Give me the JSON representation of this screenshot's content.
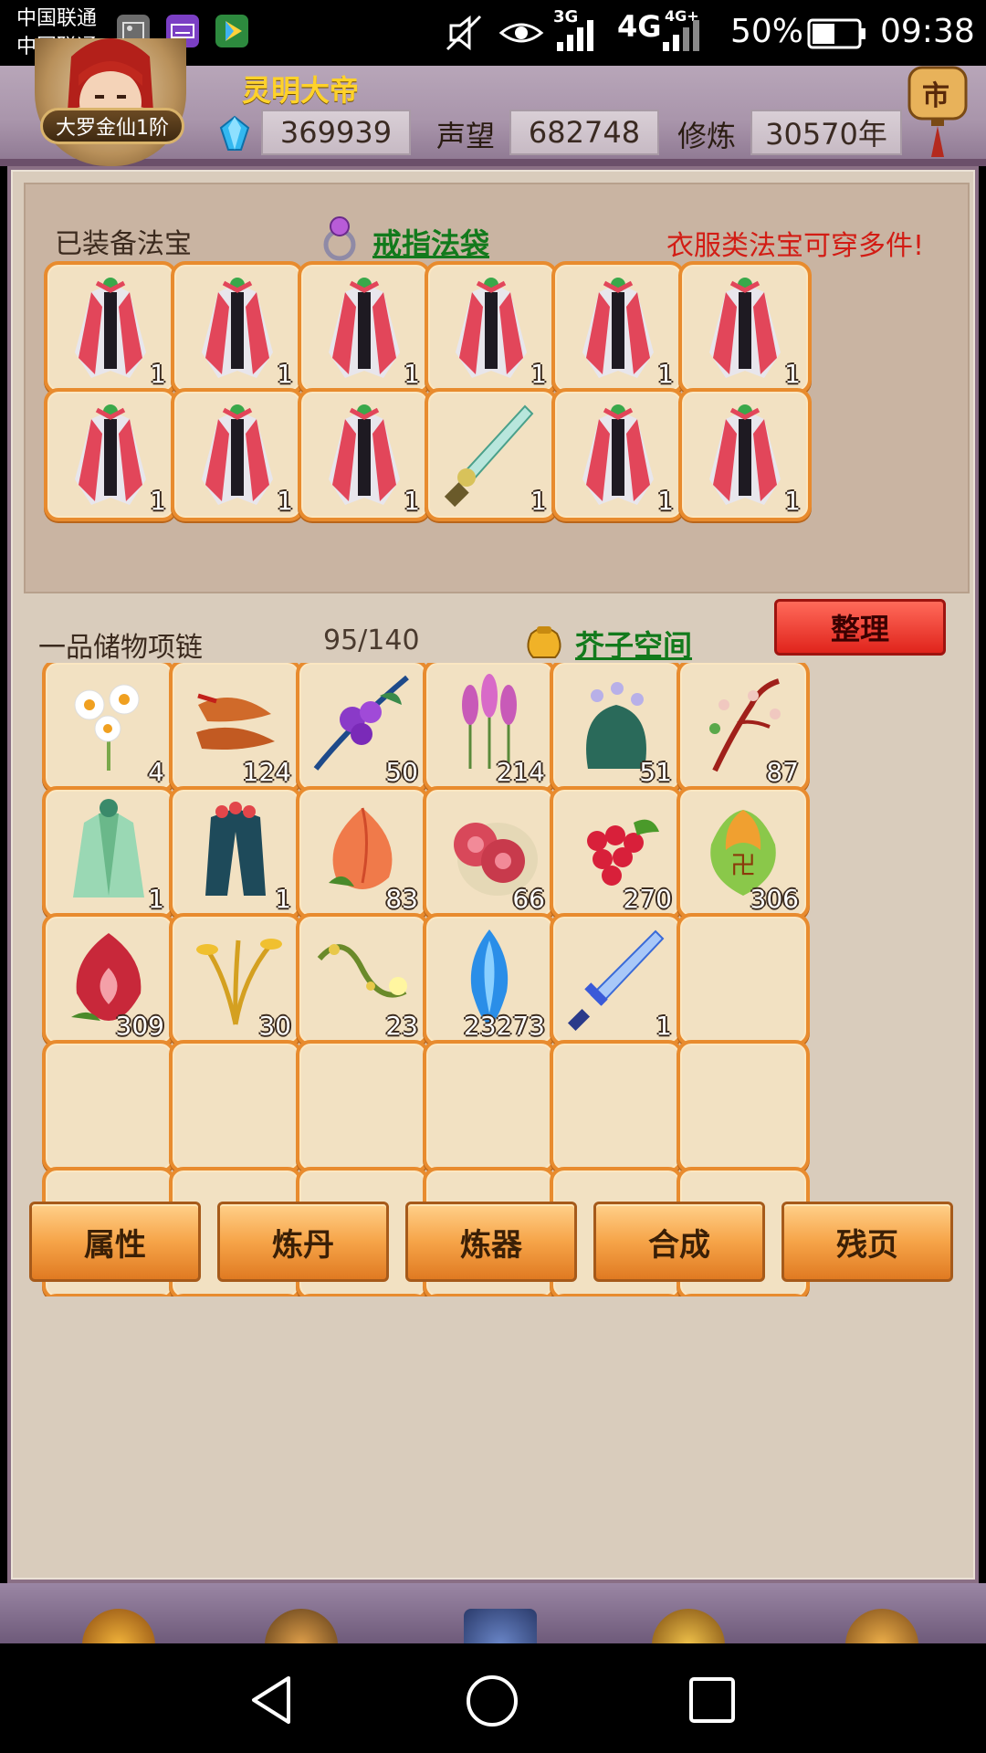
{
  "statusbar": {
    "carrier1": "中国联通",
    "carrier2": "中国联通",
    "net_3g": "3G",
    "net_4g": "4G",
    "net_4g_plus": "4G+",
    "battery": "50%",
    "time": "09:38"
  },
  "player": {
    "name": "灵明大帝",
    "rank": "大罗金仙1阶",
    "gems": "369939",
    "reputation_label": "声望",
    "reputation": "682748",
    "cultivation_label": "修炼",
    "cultivation": "30570年",
    "lantern_char": "市"
  },
  "equipped": {
    "title": "已装备法宝",
    "ring_bag_link": "戒指法袋",
    "notice": "衣服类法宝可穿多件!",
    "slots": [
      {
        "icon": "robe-icon",
        "count": "1"
      },
      {
        "icon": "robe-icon",
        "count": "1"
      },
      {
        "icon": "robe-icon",
        "count": "1"
      },
      {
        "icon": "robe-icon",
        "count": "1"
      },
      {
        "icon": "robe-icon",
        "count": "1"
      },
      {
        "icon": "robe-icon",
        "count": "1"
      },
      {
        "icon": "robe-icon",
        "count": "1"
      },
      {
        "icon": "robe-icon",
        "count": "1"
      },
      {
        "icon": "robe-icon",
        "count": "1"
      },
      {
        "icon": "jade-sword-icon",
        "count": "1"
      },
      {
        "icon": "robe-icon",
        "count": "1"
      },
      {
        "icon": "robe-icon",
        "count": "1"
      }
    ]
  },
  "bag": {
    "title": "一品储物项链",
    "capacity": "95/140",
    "space_link": "芥子空间",
    "sort_label": "整理",
    "slots": [
      {
        "icon": "daisy-herb-icon",
        "count": "4"
      },
      {
        "icon": "ginseng-root-icon",
        "count": "124"
      },
      {
        "icon": "purple-berry-branch-icon",
        "count": "50"
      },
      {
        "icon": "lavender-herb-icon",
        "count": "214"
      },
      {
        "icon": "green-leaf-herb-icon",
        "count": "51"
      },
      {
        "icon": "blossom-branch-icon",
        "count": "87"
      },
      {
        "icon": "green-robe-icon",
        "count": "1"
      },
      {
        "icon": "dark-robe-icon",
        "count": "1"
      },
      {
        "icon": "peach-icon",
        "count": "83"
      },
      {
        "icon": "red-pill-icon",
        "count": "66"
      },
      {
        "icon": "raspberry-icon",
        "count": "270"
      },
      {
        "icon": "golden-lotus-icon",
        "count": "306"
      },
      {
        "icon": "red-bud-icon",
        "count": "309"
      },
      {
        "icon": "golden-grass-icon",
        "count": "30"
      },
      {
        "icon": "vine-icon",
        "count": "23"
      },
      {
        "icon": "blue-crystal-icon",
        "count": "23273"
      },
      {
        "icon": "ice-sword-icon",
        "count": "1"
      },
      {
        "icon": "",
        "count": ""
      },
      {
        "icon": "",
        "count": ""
      },
      {
        "icon": "",
        "count": ""
      },
      {
        "icon": "",
        "count": ""
      },
      {
        "icon": "",
        "count": ""
      },
      {
        "icon": "",
        "count": ""
      },
      {
        "icon": "",
        "count": ""
      },
      {
        "icon": "",
        "count": ""
      },
      {
        "icon": "",
        "count": ""
      },
      {
        "icon": "",
        "count": ""
      },
      {
        "icon": "",
        "count": ""
      },
      {
        "icon": "",
        "count": ""
      },
      {
        "icon": "",
        "count": ""
      },
      {
        "icon": "",
        "count": ""
      },
      {
        "icon": "",
        "count": ""
      },
      {
        "icon": "",
        "count": ""
      },
      {
        "icon": "",
        "count": ""
      },
      {
        "icon": "",
        "count": ""
      },
      {
        "icon": "",
        "count": ""
      }
    ]
  },
  "actions": [
    "属性",
    "炼丹",
    "炼器",
    "合成",
    "残页"
  ],
  "colors": {
    "slot_border": "#e88b2e",
    "slot_fill": "#f2e1c2",
    "link_green": "#127a1c",
    "notice_red": "#d21c14",
    "name_gold": "#ffd22a"
  }
}
